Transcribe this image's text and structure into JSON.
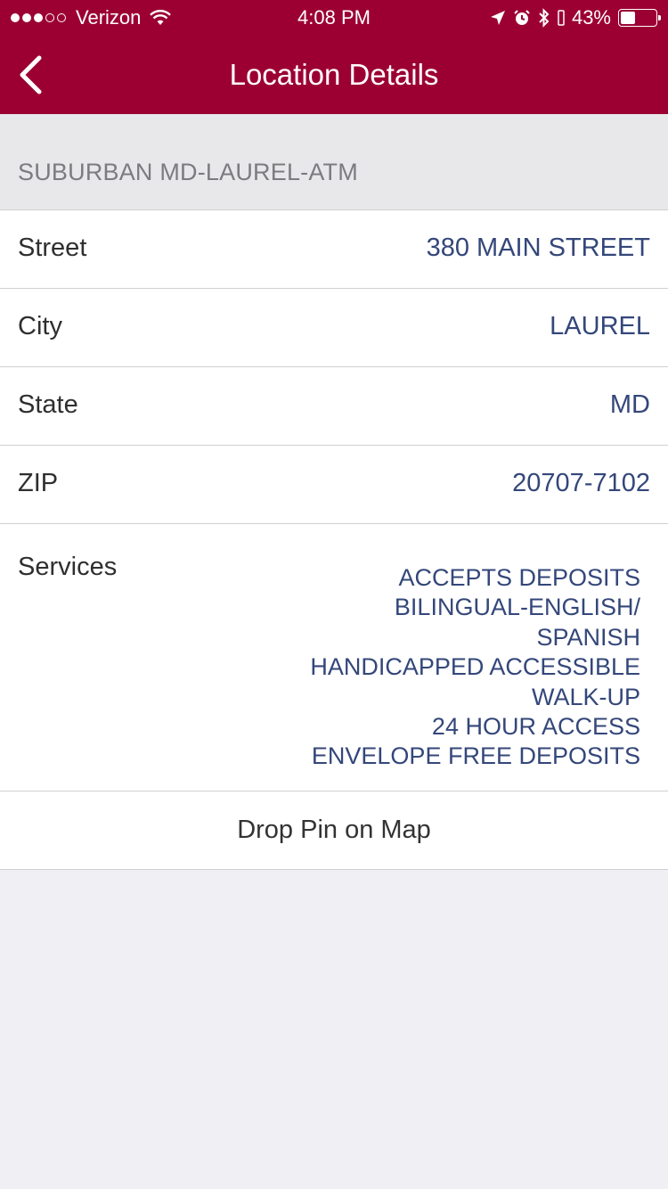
{
  "status_bar": {
    "carrier": "Verizon",
    "time": "4:08 PM",
    "battery_percent": "43%",
    "battery_level": 0.43,
    "signal_strength": 3,
    "signal_max": 5
  },
  "nav": {
    "title": "Location Details",
    "back_icon": "chevron-left-icon"
  },
  "location": {
    "name": "SUBURBAN MD-LAUREL-ATM"
  },
  "details": [
    {
      "label": "Street",
      "value": "380 MAIN STREET"
    },
    {
      "label": "City",
      "value": "LAUREL"
    },
    {
      "label": "State",
      "value": "MD"
    },
    {
      "label": "ZIP",
      "value": "20707-7102"
    }
  ],
  "services": {
    "label": "Services",
    "items": [
      "ACCEPTS DEPOSITS",
      "BILINGUAL-ENGLISH/ SPANISH",
      "HANDICAPPED ACCESSIBLE",
      "WALK-UP",
      "24 HOUR ACCESS",
      "ENVELOPE FREE DEPOSITS"
    ]
  },
  "actions": {
    "drop_pin_label": "Drop Pin on Map"
  },
  "colors": {
    "brand": "#9c0033",
    "value_text": "#34477a",
    "background": "#efeff4"
  }
}
